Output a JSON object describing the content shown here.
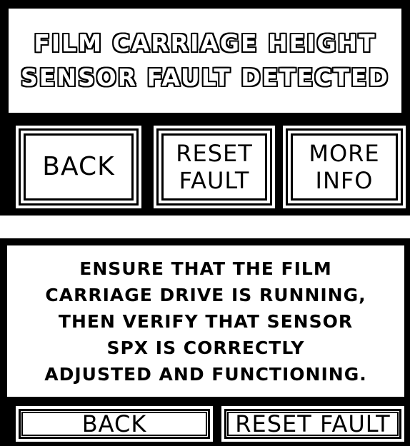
{
  "screen1": {
    "message_lines": [
      "FILM CARRIAGE HEIGHT",
      "SENSOR FAULT DETECTED"
    ],
    "buttons": {
      "back": "BACK",
      "reset_line1": "RESET",
      "reset_line2": "FAULT",
      "more_line1": "MORE",
      "more_line2": "INFO"
    }
  },
  "screen2": {
    "info_lines": [
      "ENSURE THAT THE FILM",
      "CARRIAGE DRIVE IS RUNNING,",
      "THEN VERIFY THAT SENSOR",
      "SPX IS CORRECTLY",
      "ADJUSTED AND FUNCTIONING."
    ],
    "buttons": {
      "back": "BACK",
      "reset": "RESET FAULT"
    }
  },
  "colors": {
    "background": "#000000",
    "panel": "#ffffff",
    "text": "#000000"
  }
}
